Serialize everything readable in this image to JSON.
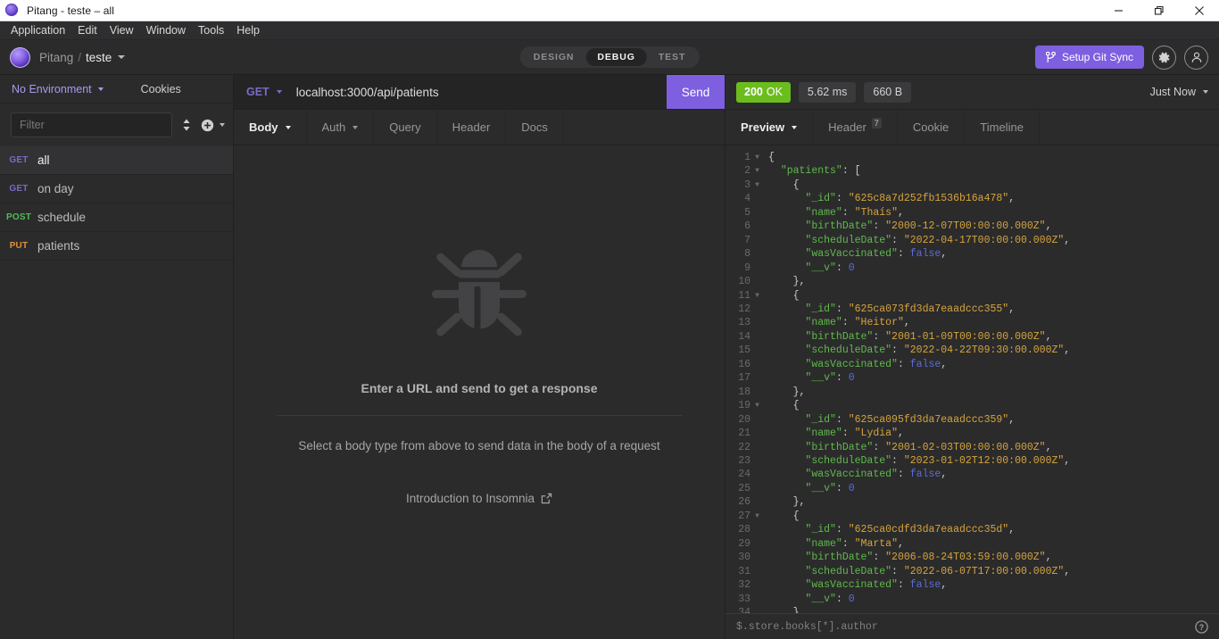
{
  "window": {
    "title": "Pitang - teste – all",
    "app_icon": "insomnia-logo-icon",
    "controls": [
      {
        "name": "minimize-button",
        "icon": "minimize-icon"
      },
      {
        "name": "restore-button",
        "icon": "restore-icon"
      },
      {
        "name": "close-button",
        "icon": "close-icon"
      }
    ]
  },
  "menubar": {
    "items": [
      "Application",
      "Edit",
      "View",
      "Window",
      "Tools",
      "Help"
    ]
  },
  "header": {
    "breadcrumb": {
      "workspace": "Pitang",
      "separator": "/",
      "project": "teste"
    },
    "modes": [
      {
        "label": "DESIGN",
        "active": false
      },
      {
        "label": "DEBUG",
        "active": true
      },
      {
        "label": "TEST",
        "active": false
      }
    ],
    "git_sync_label": "Setup Git Sync",
    "git_icon": "git-branch-icon",
    "settings_icon": "gear-icon",
    "account_icon": "account-icon"
  },
  "sidebar": {
    "environment": "No Environment",
    "cookies_label": "Cookies",
    "filter_placeholder": "Filter",
    "sort_icon": "sort-icon",
    "add_icon": "plus-circle-icon",
    "requests": [
      {
        "method": "GET",
        "name": "all",
        "active": true
      },
      {
        "method": "GET",
        "name": "on day",
        "active": false
      },
      {
        "method": "POST",
        "name": "schedule",
        "active": false
      },
      {
        "method": "PUT",
        "name": "patients",
        "active": false
      }
    ]
  },
  "request": {
    "method": "GET",
    "url": "localhost:3000/api/patients",
    "send_label": "Send",
    "tabs": [
      {
        "label": "Body",
        "active": true,
        "caret": true,
        "dim_caret": false
      },
      {
        "label": "Auth",
        "active": false,
        "caret": true,
        "dim_caret": true
      },
      {
        "label": "Query",
        "active": false,
        "caret": false,
        "dim_caret": false
      },
      {
        "label": "Header",
        "active": false,
        "caret": false,
        "dim_caret": false
      },
      {
        "label": "Docs",
        "active": false,
        "caret": false,
        "dim_caret": false
      }
    ],
    "empty_state": {
      "icon": "bug-icon",
      "heading": "Enter a URL and send to get a response",
      "subtext": "Select a body type from above to send data in the body of a request",
      "link_label": "Introduction to Insomnia",
      "link_icon": "external-link-icon"
    }
  },
  "response": {
    "status": {
      "code": "200",
      "text": "OK"
    },
    "time": "5.62 ms",
    "size": "660 B",
    "timestamp": "Just Now",
    "tabs": [
      {
        "label": "Preview",
        "active": true,
        "caret": true,
        "badge": ""
      },
      {
        "label": "Header",
        "active": false,
        "caret": false,
        "badge": "7"
      },
      {
        "label": "Cookie",
        "active": false,
        "caret": false,
        "badge": ""
      },
      {
        "label": "Timeline",
        "active": false,
        "caret": false,
        "badge": ""
      }
    ],
    "jsonpath_placeholder": "$.store.books[*].author",
    "help_icon": "help-circle-icon",
    "body_lines": [
      {
        "n": 1,
        "fold": true,
        "tokens": [
          {
            "t": "p",
            "v": "{"
          }
        ]
      },
      {
        "n": 2,
        "fold": true,
        "tokens": [
          {
            "t": "p",
            "v": "  "
          },
          {
            "t": "k",
            "v": "\"patients\""
          },
          {
            "t": "p",
            "v": ": ["
          }
        ]
      },
      {
        "n": 3,
        "fold": true,
        "tokens": [
          {
            "t": "p",
            "v": "    {"
          }
        ]
      },
      {
        "n": 4,
        "fold": false,
        "tokens": [
          {
            "t": "p",
            "v": "      "
          },
          {
            "t": "k",
            "v": "\"_id\""
          },
          {
            "t": "p",
            "v": ": "
          },
          {
            "t": "s",
            "v": "\"625c8a7d252fb1536b16a478\""
          },
          {
            "t": "p",
            "v": ","
          }
        ]
      },
      {
        "n": 5,
        "fold": false,
        "tokens": [
          {
            "t": "p",
            "v": "      "
          },
          {
            "t": "k",
            "v": "\"name\""
          },
          {
            "t": "p",
            "v": ": "
          },
          {
            "t": "s",
            "v": "\"Thaís\""
          },
          {
            "t": "p",
            "v": ","
          }
        ]
      },
      {
        "n": 6,
        "fold": false,
        "tokens": [
          {
            "t": "p",
            "v": "      "
          },
          {
            "t": "k",
            "v": "\"birthDate\""
          },
          {
            "t": "p",
            "v": ": "
          },
          {
            "t": "s",
            "v": "\"2000-12-07T00:00:00.000Z\""
          },
          {
            "t": "p",
            "v": ","
          }
        ]
      },
      {
        "n": 7,
        "fold": false,
        "tokens": [
          {
            "t": "p",
            "v": "      "
          },
          {
            "t": "k",
            "v": "\"scheduleDate\""
          },
          {
            "t": "p",
            "v": ": "
          },
          {
            "t": "s",
            "v": "\"2022-04-17T00:00:00.000Z\""
          },
          {
            "t": "p",
            "v": ","
          }
        ]
      },
      {
        "n": 8,
        "fold": false,
        "tokens": [
          {
            "t": "p",
            "v": "      "
          },
          {
            "t": "k",
            "v": "\"wasVaccinated\""
          },
          {
            "t": "p",
            "v": ": "
          },
          {
            "t": "b",
            "v": "false"
          },
          {
            "t": "p",
            "v": ","
          }
        ]
      },
      {
        "n": 9,
        "fold": false,
        "tokens": [
          {
            "t": "p",
            "v": "      "
          },
          {
            "t": "k",
            "v": "\"__v\""
          },
          {
            "t": "p",
            "v": ": "
          },
          {
            "t": "n",
            "v": "0"
          }
        ]
      },
      {
        "n": 10,
        "fold": false,
        "tokens": [
          {
            "t": "p",
            "v": "    },"
          }
        ]
      },
      {
        "n": 11,
        "fold": true,
        "tokens": [
          {
            "t": "p",
            "v": "    {"
          }
        ]
      },
      {
        "n": 12,
        "fold": false,
        "tokens": [
          {
            "t": "p",
            "v": "      "
          },
          {
            "t": "k",
            "v": "\"_id\""
          },
          {
            "t": "p",
            "v": ": "
          },
          {
            "t": "s",
            "v": "\"625ca073fd3da7eaadccc355\""
          },
          {
            "t": "p",
            "v": ","
          }
        ]
      },
      {
        "n": 13,
        "fold": false,
        "tokens": [
          {
            "t": "p",
            "v": "      "
          },
          {
            "t": "k",
            "v": "\"name\""
          },
          {
            "t": "p",
            "v": ": "
          },
          {
            "t": "s",
            "v": "\"Heitor\""
          },
          {
            "t": "p",
            "v": ","
          }
        ]
      },
      {
        "n": 14,
        "fold": false,
        "tokens": [
          {
            "t": "p",
            "v": "      "
          },
          {
            "t": "k",
            "v": "\"birthDate\""
          },
          {
            "t": "p",
            "v": ": "
          },
          {
            "t": "s",
            "v": "\"2001-01-09T00:00:00.000Z\""
          },
          {
            "t": "p",
            "v": ","
          }
        ]
      },
      {
        "n": 15,
        "fold": false,
        "tokens": [
          {
            "t": "p",
            "v": "      "
          },
          {
            "t": "k",
            "v": "\"scheduleDate\""
          },
          {
            "t": "p",
            "v": ": "
          },
          {
            "t": "s",
            "v": "\"2022-04-22T09:30:00.000Z\""
          },
          {
            "t": "p",
            "v": ","
          }
        ]
      },
      {
        "n": 16,
        "fold": false,
        "tokens": [
          {
            "t": "p",
            "v": "      "
          },
          {
            "t": "k",
            "v": "\"wasVaccinated\""
          },
          {
            "t": "p",
            "v": ": "
          },
          {
            "t": "b",
            "v": "false"
          },
          {
            "t": "p",
            "v": ","
          }
        ]
      },
      {
        "n": 17,
        "fold": false,
        "tokens": [
          {
            "t": "p",
            "v": "      "
          },
          {
            "t": "k",
            "v": "\"__v\""
          },
          {
            "t": "p",
            "v": ": "
          },
          {
            "t": "n",
            "v": "0"
          }
        ]
      },
      {
        "n": 18,
        "fold": false,
        "tokens": [
          {
            "t": "p",
            "v": "    },"
          }
        ]
      },
      {
        "n": 19,
        "fold": true,
        "tokens": [
          {
            "t": "p",
            "v": "    {"
          }
        ]
      },
      {
        "n": 20,
        "fold": false,
        "tokens": [
          {
            "t": "p",
            "v": "      "
          },
          {
            "t": "k",
            "v": "\"_id\""
          },
          {
            "t": "p",
            "v": ": "
          },
          {
            "t": "s",
            "v": "\"625ca095fd3da7eaadccc359\""
          },
          {
            "t": "p",
            "v": ","
          }
        ]
      },
      {
        "n": 21,
        "fold": false,
        "tokens": [
          {
            "t": "p",
            "v": "      "
          },
          {
            "t": "k",
            "v": "\"name\""
          },
          {
            "t": "p",
            "v": ": "
          },
          {
            "t": "s",
            "v": "\"Lydia\""
          },
          {
            "t": "p",
            "v": ","
          }
        ]
      },
      {
        "n": 22,
        "fold": false,
        "tokens": [
          {
            "t": "p",
            "v": "      "
          },
          {
            "t": "k",
            "v": "\"birthDate\""
          },
          {
            "t": "p",
            "v": ": "
          },
          {
            "t": "s",
            "v": "\"2001-02-03T00:00:00.000Z\""
          },
          {
            "t": "p",
            "v": ","
          }
        ]
      },
      {
        "n": 23,
        "fold": false,
        "tokens": [
          {
            "t": "p",
            "v": "      "
          },
          {
            "t": "k",
            "v": "\"scheduleDate\""
          },
          {
            "t": "p",
            "v": ": "
          },
          {
            "t": "s",
            "v": "\"2023-01-02T12:00:00.000Z\""
          },
          {
            "t": "p",
            "v": ","
          }
        ]
      },
      {
        "n": 24,
        "fold": false,
        "tokens": [
          {
            "t": "p",
            "v": "      "
          },
          {
            "t": "k",
            "v": "\"wasVaccinated\""
          },
          {
            "t": "p",
            "v": ": "
          },
          {
            "t": "b",
            "v": "false"
          },
          {
            "t": "p",
            "v": ","
          }
        ]
      },
      {
        "n": 25,
        "fold": false,
        "tokens": [
          {
            "t": "p",
            "v": "      "
          },
          {
            "t": "k",
            "v": "\"__v\""
          },
          {
            "t": "p",
            "v": ": "
          },
          {
            "t": "n",
            "v": "0"
          }
        ]
      },
      {
        "n": 26,
        "fold": false,
        "tokens": [
          {
            "t": "p",
            "v": "    },"
          }
        ]
      },
      {
        "n": 27,
        "fold": true,
        "tokens": [
          {
            "t": "p",
            "v": "    {"
          }
        ]
      },
      {
        "n": 28,
        "fold": false,
        "tokens": [
          {
            "t": "p",
            "v": "      "
          },
          {
            "t": "k",
            "v": "\"_id\""
          },
          {
            "t": "p",
            "v": ": "
          },
          {
            "t": "s",
            "v": "\"625ca0cdfd3da7eaadccc35d\""
          },
          {
            "t": "p",
            "v": ","
          }
        ]
      },
      {
        "n": 29,
        "fold": false,
        "tokens": [
          {
            "t": "p",
            "v": "      "
          },
          {
            "t": "k",
            "v": "\"name\""
          },
          {
            "t": "p",
            "v": ": "
          },
          {
            "t": "s",
            "v": "\"Marta\""
          },
          {
            "t": "p",
            "v": ","
          }
        ]
      },
      {
        "n": 30,
        "fold": false,
        "tokens": [
          {
            "t": "p",
            "v": "      "
          },
          {
            "t": "k",
            "v": "\"birthDate\""
          },
          {
            "t": "p",
            "v": ": "
          },
          {
            "t": "s",
            "v": "\"2006-08-24T03:59:00.000Z\""
          },
          {
            "t": "p",
            "v": ","
          }
        ]
      },
      {
        "n": 31,
        "fold": false,
        "tokens": [
          {
            "t": "p",
            "v": "      "
          },
          {
            "t": "k",
            "v": "\"scheduleDate\""
          },
          {
            "t": "p",
            "v": ": "
          },
          {
            "t": "s",
            "v": "\"2022-06-07T17:00:00.000Z\""
          },
          {
            "t": "p",
            "v": ","
          }
        ]
      },
      {
        "n": 32,
        "fold": false,
        "tokens": [
          {
            "t": "p",
            "v": "      "
          },
          {
            "t": "k",
            "v": "\"wasVaccinated\""
          },
          {
            "t": "p",
            "v": ": "
          },
          {
            "t": "b",
            "v": "false"
          },
          {
            "t": "p",
            "v": ","
          }
        ]
      },
      {
        "n": 33,
        "fold": false,
        "tokens": [
          {
            "t": "p",
            "v": "      "
          },
          {
            "t": "k",
            "v": "\"__v\""
          },
          {
            "t": "p",
            "v": ": "
          },
          {
            "t": "n",
            "v": "0"
          }
        ]
      },
      {
        "n": 34,
        "fold": false,
        "tokens": [
          {
            "t": "p",
            "v": "    }"
          }
        ]
      }
    ]
  },
  "colors": {
    "accent": "#7d5fe0",
    "get": "#7d69ca",
    "post": "#53ba57",
    "put": "#e1913b",
    "status_ok": "#6bbd1e",
    "bg": "#2b2b2c"
  }
}
